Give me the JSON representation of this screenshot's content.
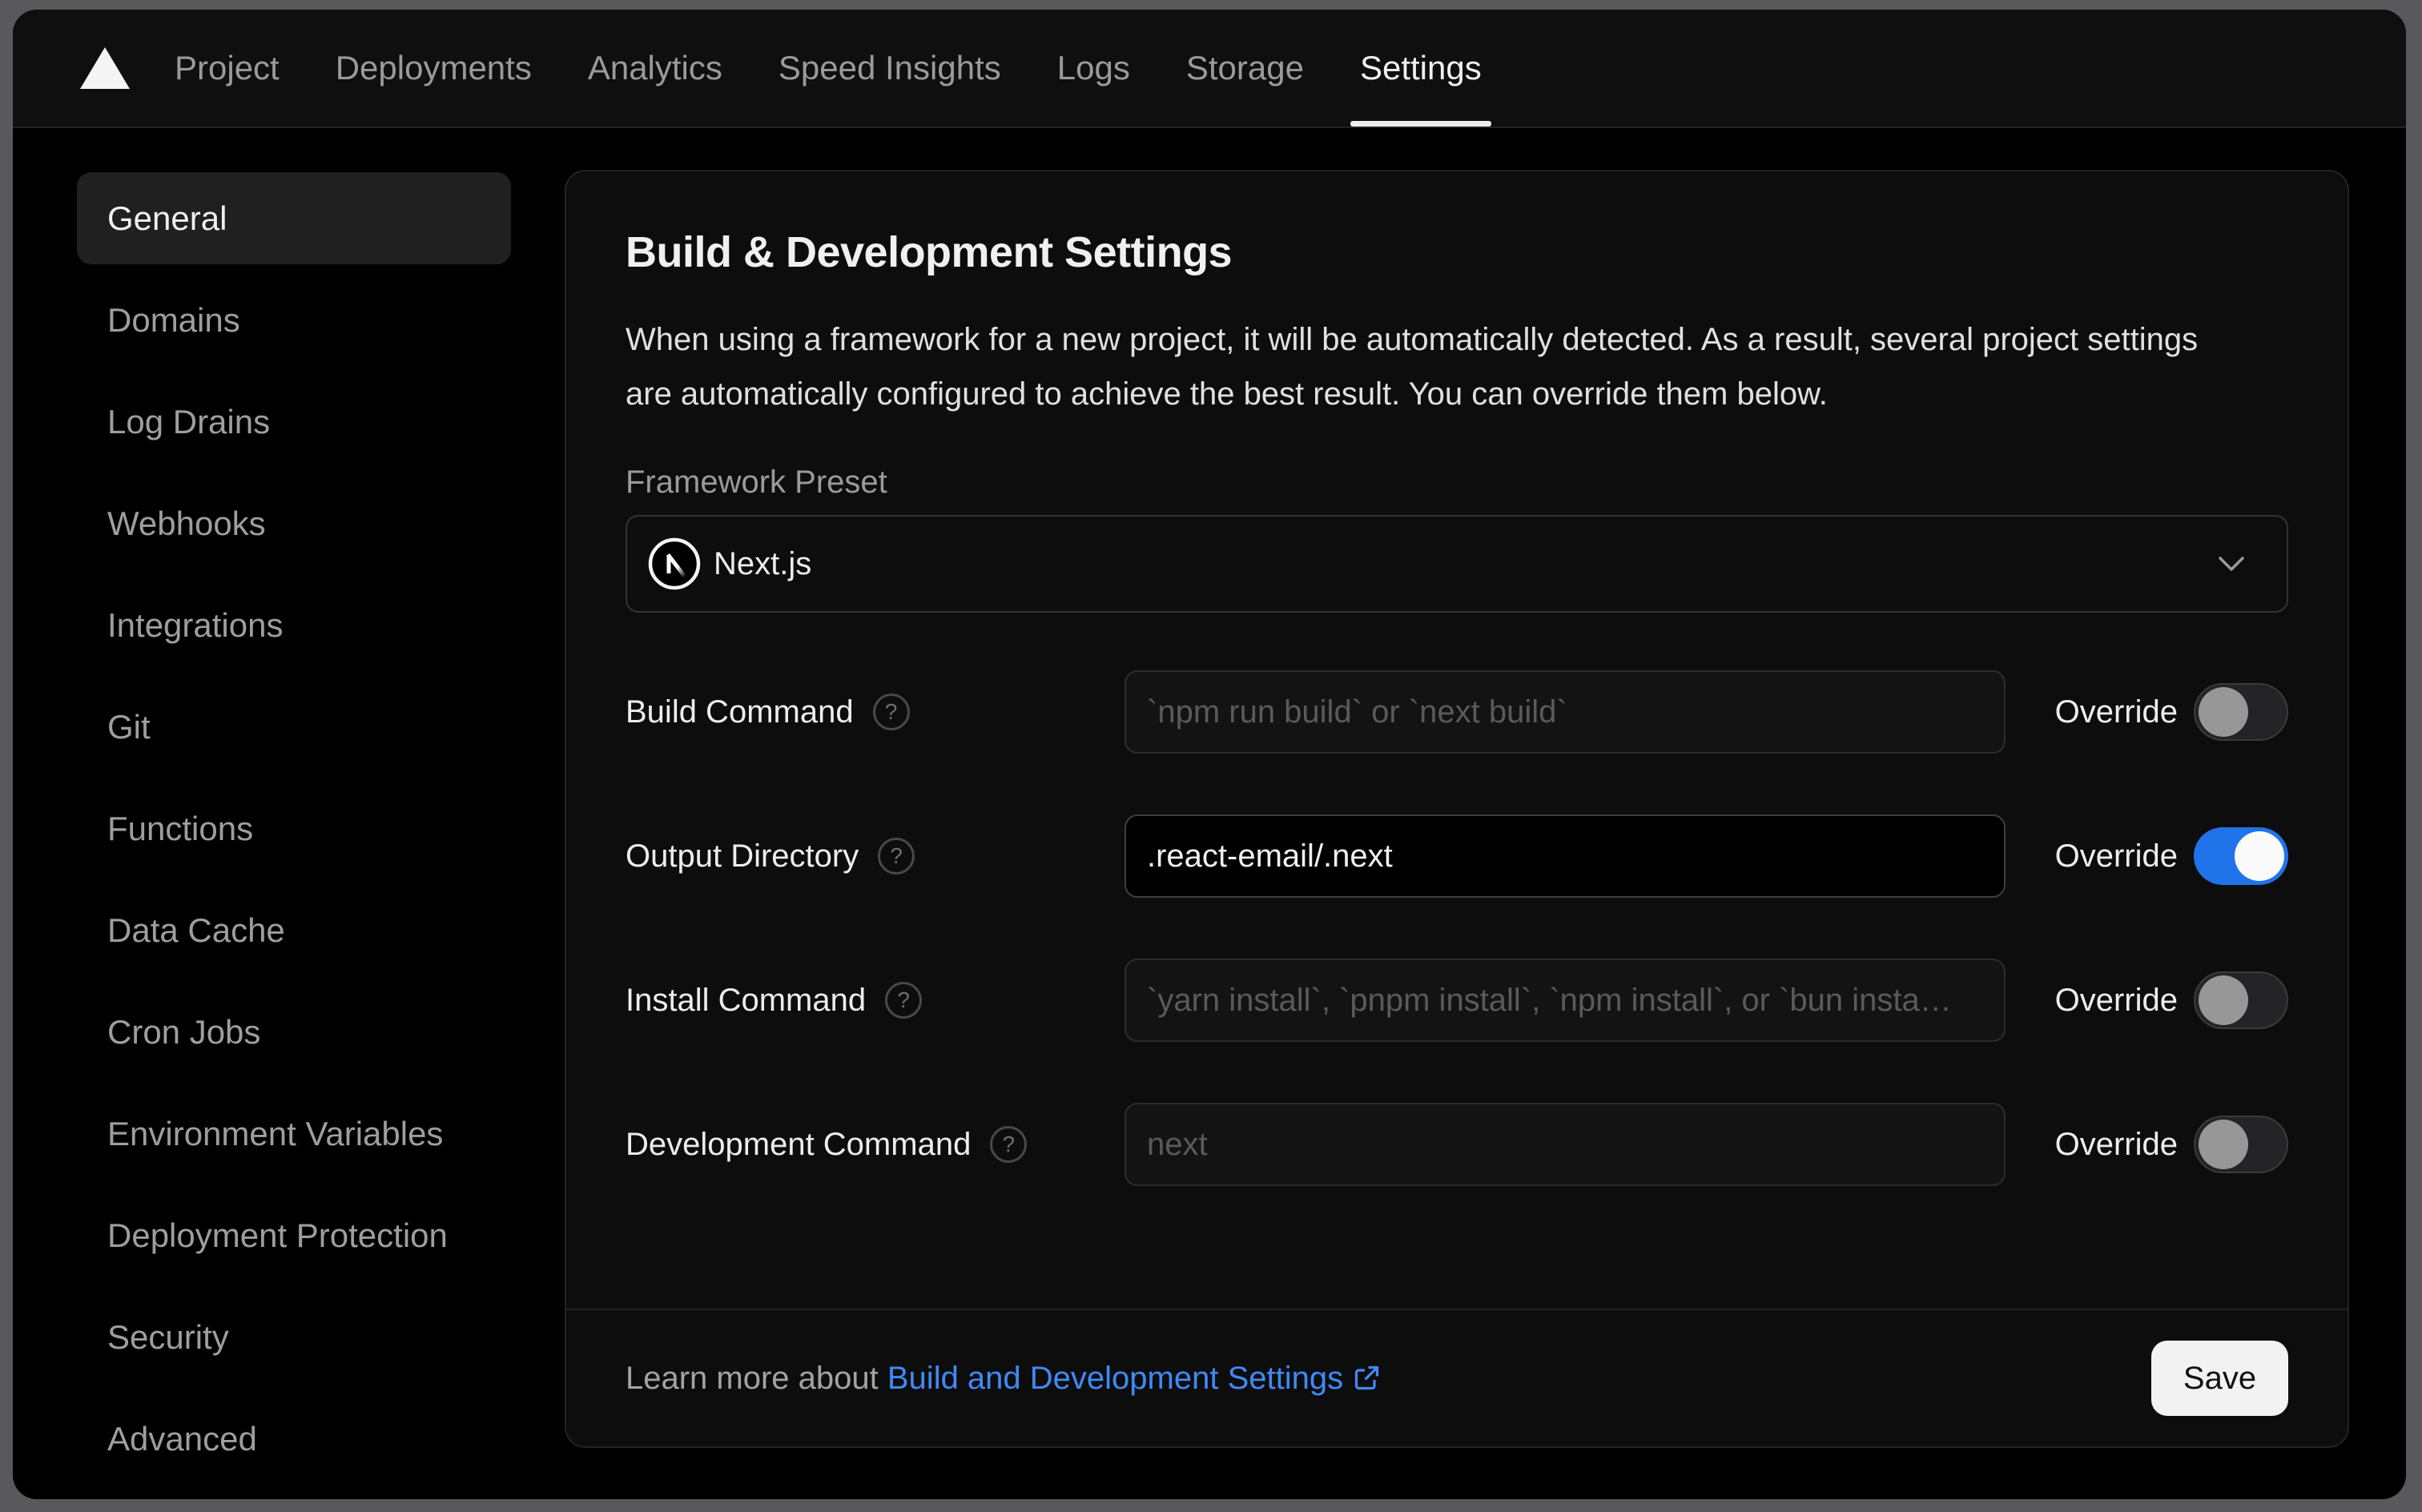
{
  "nav": {
    "tabs": [
      {
        "label": "Project",
        "active": false
      },
      {
        "label": "Deployments",
        "active": false
      },
      {
        "label": "Analytics",
        "active": false
      },
      {
        "label": "Speed Insights",
        "active": false
      },
      {
        "label": "Logs",
        "active": false
      },
      {
        "label": "Storage",
        "active": false
      },
      {
        "label": "Settings",
        "active": true
      }
    ]
  },
  "sidebar": {
    "items": [
      {
        "label": "General",
        "active": true
      },
      {
        "label": "Domains",
        "active": false
      },
      {
        "label": "Log Drains",
        "active": false
      },
      {
        "label": "Webhooks",
        "active": false
      },
      {
        "label": "Integrations",
        "active": false
      },
      {
        "label": "Git",
        "active": false
      },
      {
        "label": "Functions",
        "active": false
      },
      {
        "label": "Data Cache",
        "active": false
      },
      {
        "label": "Cron Jobs",
        "active": false
      },
      {
        "label": "Environment Variables",
        "active": false
      },
      {
        "label": "Deployment Protection",
        "active": false
      },
      {
        "label": "Security",
        "active": false
      },
      {
        "label": "Advanced",
        "active": false
      }
    ]
  },
  "panel": {
    "title": "Build & Development Settings",
    "description": "When using a framework for a new project, it will be automatically detected. As a result, several project settings are automatically configured to achieve the best result. You can override them below.",
    "framework_preset": {
      "label": "Framework Preset",
      "value": "Next.js"
    },
    "override_label": "Override",
    "rows": [
      {
        "label": "Build Command",
        "placeholder": "`npm run build` or `next build`",
        "value": "",
        "override": false
      },
      {
        "label": "Output Directory",
        "placeholder": "",
        "value": ".react-email/.next",
        "override": true
      },
      {
        "label": "Install Command",
        "placeholder": "`yarn install`, `pnpm install`, `npm install`, or `bun insta…",
        "value": "",
        "override": false
      },
      {
        "label": "Development Command",
        "placeholder": "next",
        "value": "",
        "override": false
      }
    ],
    "footer": {
      "learn_more_prefix": "Learn more about ",
      "link_text": "Build and Development Settings",
      "save_label": "Save"
    }
  },
  "icons": {
    "logo": "vercel-triangle",
    "framework": "nextjs-logo",
    "help_glyph": "?",
    "chevron": "chevron-down",
    "external_link": "external-link"
  },
  "colors": {
    "toggle_on_blue": "#2173e9",
    "link_blue": "#4189f6",
    "card_background": "#0d0d0d",
    "page_background": "#000000",
    "save_button": "#f2f2f2"
  }
}
